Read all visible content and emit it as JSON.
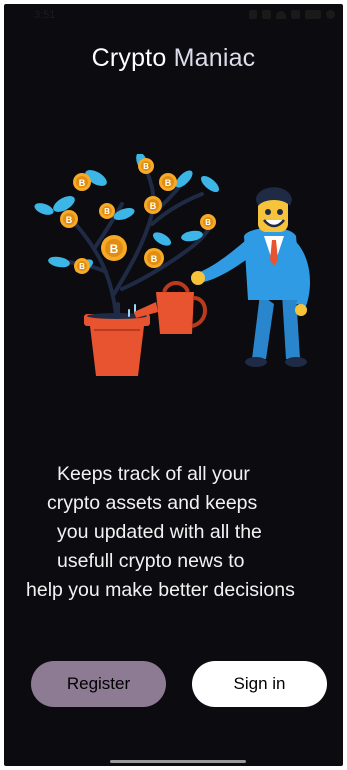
{
  "status_bar": {
    "time": "3:51",
    "icons": [
      "app-icon",
      "gallery-icon",
      "wifi-icon",
      "signal-icon",
      "battery-icon",
      "sync-icon"
    ]
  },
  "app": {
    "title_part1": "Crypto",
    "title_part2": "Maniac"
  },
  "illustration": {
    "coin_symbol": "B",
    "description_icons": [
      "money-tree-icon",
      "businessman-icon",
      "watering-can-icon"
    ]
  },
  "tagline": {
    "lines": [
      "Keeps track of all your",
      "crypto assets and keeps",
      "you updated with all the",
      "usefull crypto news to",
      "help you make better decisions"
    ]
  },
  "buttons": {
    "register_label": "Register",
    "signin_label": "Sign in"
  },
  "colors": {
    "background": "#0c0b10",
    "register_button": "#8d7a93",
    "signin_button": "#ffffff",
    "coin": "#f7a928",
    "leaf": "#3bb6e6",
    "suit": "#2f9be4",
    "pot": "#e8542f"
  }
}
